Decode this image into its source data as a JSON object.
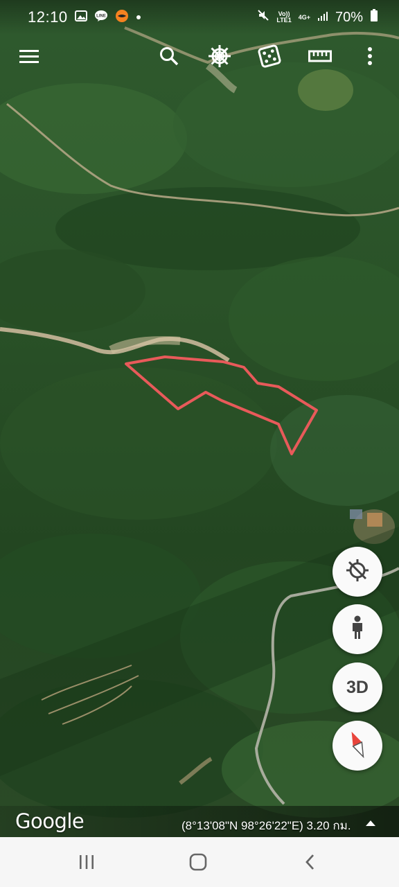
{
  "status_bar": {
    "time": "12:10",
    "notification_icons": [
      "gallery-icon",
      "line-icon",
      "message-icon",
      "dot-icon"
    ],
    "network_top": "Vo))",
    "network_bottom": "LTE1",
    "network_gen": "4G+",
    "battery": "70%"
  },
  "toolbar": {
    "icons": [
      "menu-icon",
      "search-icon",
      "voyager-icon",
      "feeling-lucky-icon",
      "measure-icon",
      "more-icon"
    ]
  },
  "map": {
    "type": "satellite",
    "boundary_color": "#e85a5a",
    "road_color": "#c9b79a"
  },
  "controls": {
    "my_location": "location-disabled-icon",
    "street_view": "pegman-icon",
    "three_d_label": "3D",
    "compass": "compass-icon"
  },
  "footer": {
    "brand": "Google",
    "coordinates": "(8°13'08\"N 98°26'22\"E) 3.20 กม."
  },
  "nav_bar": {
    "icons": [
      "recent-apps-icon",
      "home-icon",
      "back-icon"
    ]
  }
}
